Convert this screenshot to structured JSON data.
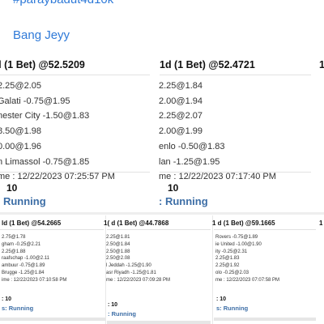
{
  "header": {
    "hashtag": "#paraybadut4d10k",
    "username": "Bang Jeyy"
  },
  "tickets": [
    {
      "title": "d (1 Bet) @52.5209",
      "lines": [
        "2.25@2.05",
        "Galati -0.75@1.95",
        "nester City -1.50@1.83",
        "8.50@1.98",
        "0.00@1.96",
        "n Limassol -0.75@1.85",
        "me : 12/22/2023 07:25:57 PM"
      ],
      "bet_num": "10",
      "status": ": Running"
    },
    {
      "title": "1d (1 Bet) @52.4721",
      "lines": [
        "2.25@1.84",
        "2.00@1.94",
        "2.25@2.07",
        "2.00@1.99",
        "enlo -0.50@1.83",
        "lan -1.25@1.95",
        "me : 12/22/2023 07:17:40 PM"
      ],
      "bet_num": "10",
      "status": ": Running"
    },
    {
      "title": "1",
      "lines": [],
      "bet_num": "",
      "status": ""
    }
  ],
  "small_tickets": [
    {
      "title": "ld (1 Bet) @54.2665",
      "lines": [
        "2.75@1.78",
        "gham -0.25@2.21",
        "2.25@1.88",
        "raafschap -1.00@2.11",
        "ambuur -0.75@1.89",
        "Brugge -1.25@1.84",
        "ime : 12/22/2023 07:10:58 PM"
      ],
      "bet_num": ": 10",
      "status": "s: Running"
    },
    {
      "title": "1( d (1 Bet) @44.7868",
      "lines": [
        "2.25@1.81",
        "2.50@1.84",
        "2.50@1.88",
        "2.50@2.08",
        "l Jeddah -1.25@1.90",
        "asr Riyadh -1.25@1.81",
        "me : 12/22/2023 07:09:28 PM"
      ],
      "bet_num": ": 10",
      "status": ": Running"
    },
    {
      "title": "1 d (1 Bet) @59.1665",
      "lines": [
        "Rovers -0.75@1.89",
        "ie United -1.00@1.90",
        "ity -0.25@2.31",
        "2.25@1.83",
        "2.25@1.92",
        "olo -0.25@2.03",
        "me : 12/22/2023 07:07:58 PM"
      ],
      "bet_num": ": 10",
      "status": "s: Running"
    },
    {
      "title": "1",
      "lines": [],
      "bet_num": "",
      "status": ""
    }
  ]
}
